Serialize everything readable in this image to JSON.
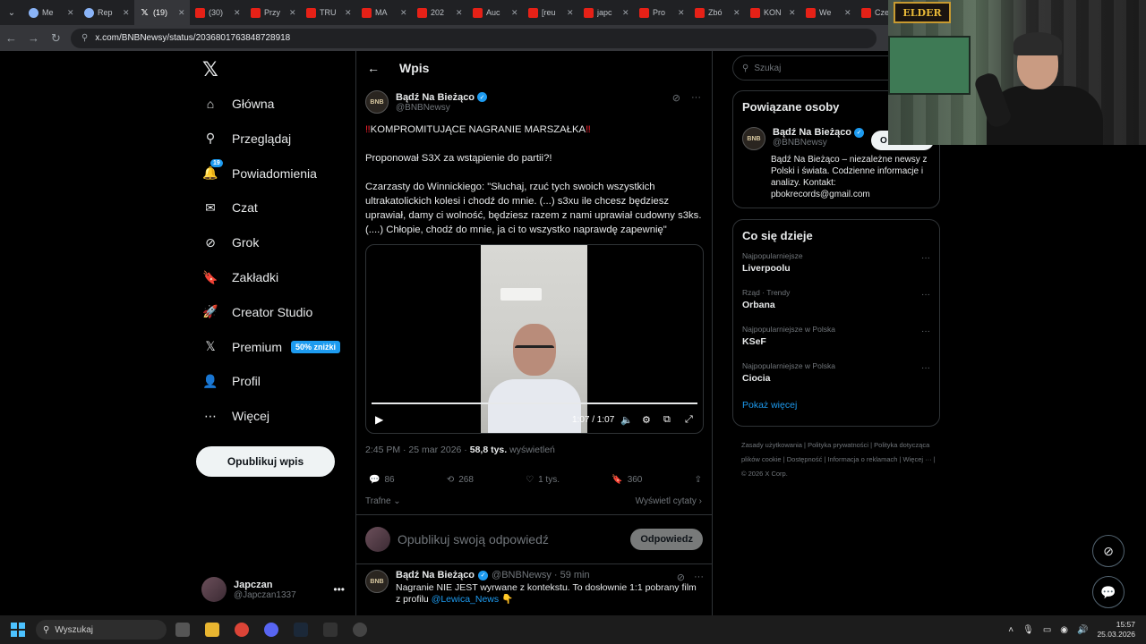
{
  "browser": {
    "tabs": [
      {
        "title": "Me",
        "icon": "globe-icon"
      },
      {
        "title": "Rep",
        "icon": "globe-icon"
      },
      {
        "title": "(19)",
        "icon": "x-icon",
        "active": true
      },
      {
        "title": "(30)",
        "icon": "youtube-icon"
      },
      {
        "title": "Przy",
        "icon": "youtube-icon"
      },
      {
        "title": "TRU",
        "icon": "youtube-icon"
      },
      {
        "title": "MA",
        "icon": "youtube-icon"
      },
      {
        "title": "202",
        "icon": "youtube-icon"
      },
      {
        "title": "Auc",
        "icon": "youtube-icon"
      },
      {
        "title": "[reu",
        "icon": "youtube-icon"
      },
      {
        "title": "japc",
        "icon": "youtube-icon"
      },
      {
        "title": "Pro",
        "icon": "youtube-icon"
      },
      {
        "title": "Zbó",
        "icon": "youtube-icon"
      },
      {
        "title": "KON",
        "icon": "youtube-icon"
      },
      {
        "title": "We",
        "icon": "youtube-icon"
      },
      {
        "title": "Cze",
        "icon": "youtube-icon"
      }
    ],
    "url": "x.com/BNBNewsy/status/2036801763848728918"
  },
  "nav": {
    "items": [
      {
        "label": "Główna",
        "icon": "home-icon"
      },
      {
        "label": "Przeglądaj",
        "icon": "search-icon"
      },
      {
        "label": "Powiadomienia",
        "icon": "bell-icon",
        "badge": "19"
      },
      {
        "label": "Czat",
        "icon": "mail-icon"
      },
      {
        "label": "Grok",
        "icon": "grok-icon"
      },
      {
        "label": "Zakładki",
        "icon": "bookmark-icon"
      },
      {
        "label": "Creator Studio",
        "icon": "rocket-icon"
      },
      {
        "label": "Premium",
        "icon": "x-icon",
        "promo": "50% zniżki"
      },
      {
        "label": "Profil",
        "icon": "person-icon"
      },
      {
        "label": "Więcej",
        "icon": "more-circle-icon"
      }
    ],
    "post_button": "Opublikuj wpis",
    "account": {
      "name": "Japczan",
      "handle": "@Japczan1337"
    }
  },
  "post": {
    "header": "Wpis",
    "author_name": "Bądź Na Bieżąco",
    "author_handle": "@BNBNewsy",
    "avatar_text": "BNB",
    "headline": "KOMPROMITUJĄCE NAGRANIE MARSZAŁKA",
    "paragraph1": "Proponował S3X za wstąpienie do partii?!",
    "paragraph2": "Czarzasty do Winnickiego: \"Słuchaj, rzuć tych swoich wszystkich ultrakatolickich kolesi i chodź do mnie. (...) s3xu ile chcesz będziesz uprawiał, damy ci wolność, będziesz razem z nami uprawiał cudowny s3ks. (....) Chłopie, chodź do mnie, ja ci to wszystko naprawdę zapewnię\"",
    "video_time": "1:07 / 1:07",
    "video_progress": 1.0,
    "time": "2:45 PM · 25 mar 2026 · ",
    "views": "58,8 tys.",
    "views_label": " wyświetleń",
    "replies": "86",
    "reposts": "268",
    "likes": "1 tys.",
    "bookmarks": "360",
    "sort_label": "Trafne",
    "quotes_label": "Wyświetl cytaty"
  },
  "reply_box": {
    "placeholder": "Opublikuj swoją odpowiedź",
    "button": "Odpowiedz"
  },
  "reply": {
    "name": "Bądź Na Bieżąco",
    "meta": "@BNBNewsy · 59 min",
    "text": "Nagranie NIE JEST wyrwane z kontekstu. To dosłownie 1:1 pobrany film z profilu ",
    "link": "@Lewica_News",
    "emoji": "👇"
  },
  "right": {
    "search_placeholder": "Szukaj",
    "related_title": "Powiązane osoby",
    "related": {
      "name": "Bądź Na Bieżąco",
      "handle": "@BNBNewsy",
      "follow": "O",
      "bio": "Bądź Na Bieżąco – niezależne newsy z Polski i świata. Codzienne informacje i analizy. Kontakt: pbokrecords@gmail.com"
    },
    "trends_title": "Co się dzieje",
    "trends": [
      {
        "category": "Najpopularniejsze",
        "name": "Liverpoolu"
      },
      {
        "category": "Rząd · Trendy",
        "name": "Orbana"
      },
      {
        "category": "Najpopularniejsze w Polska",
        "name": "KSeF"
      },
      {
        "category": "Najpopularniejsze w Polska",
        "name": "Ciocia"
      }
    ],
    "show_more": "Pokaż więcej",
    "footer": [
      "Zasady użytkowania",
      "Polityka prywatności",
      "Polityka dotycząca plików cookie",
      "Dostępność",
      "Informacja o reklamach",
      "Więcej ···",
      "© 2026 X Corp."
    ]
  },
  "webcam": {
    "logo_text": "ELDER"
  },
  "taskbar": {
    "search_placeholder": "Wyszukaj",
    "time": "15:57",
    "date": "25.03.2026"
  }
}
